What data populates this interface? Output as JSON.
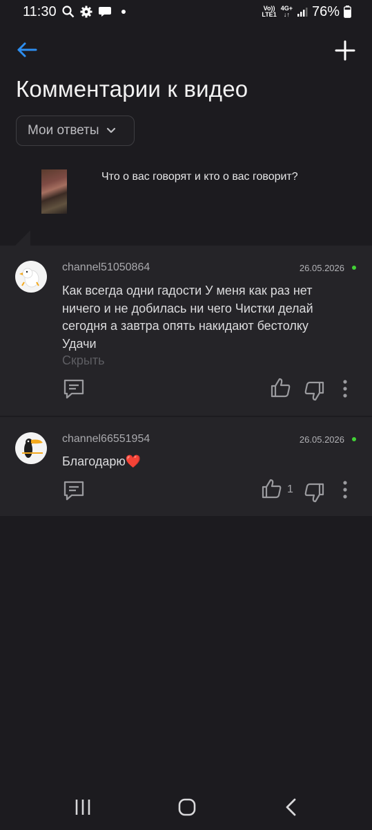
{
  "status_bar": {
    "time": "11:30",
    "volte_top": "Vo))",
    "volte_bottom": "LTE1",
    "network_top": "4G+",
    "network_bottom": "↓↑",
    "battery": "76%"
  },
  "page": {
    "title": "Комментарии к видео",
    "filter_label": "Мои ответы"
  },
  "video": {
    "title": "Что о вас говорят и кто о вас говорит?"
  },
  "comments": [
    {
      "author": "channel51050864",
      "date": "26.05.2026",
      "lines": [
        "Как всегда одни гадости У меня как раз нет",
        "ничего и не добилась ни чего Чистки делай",
        "сегодня а завтра опять накидают бестолку",
        "Удачи"
      ],
      "hide_label": "Скрыть",
      "like_count": ""
    },
    {
      "author": "channel66551954",
      "date": "26.05.2026",
      "text": "Благодарю❤️",
      "like_count": "1"
    }
  ],
  "colors": {
    "background": "#1c1b1f",
    "card": "#252428",
    "accent_blue": "#2d8ef0",
    "online_green": "#42d236"
  }
}
